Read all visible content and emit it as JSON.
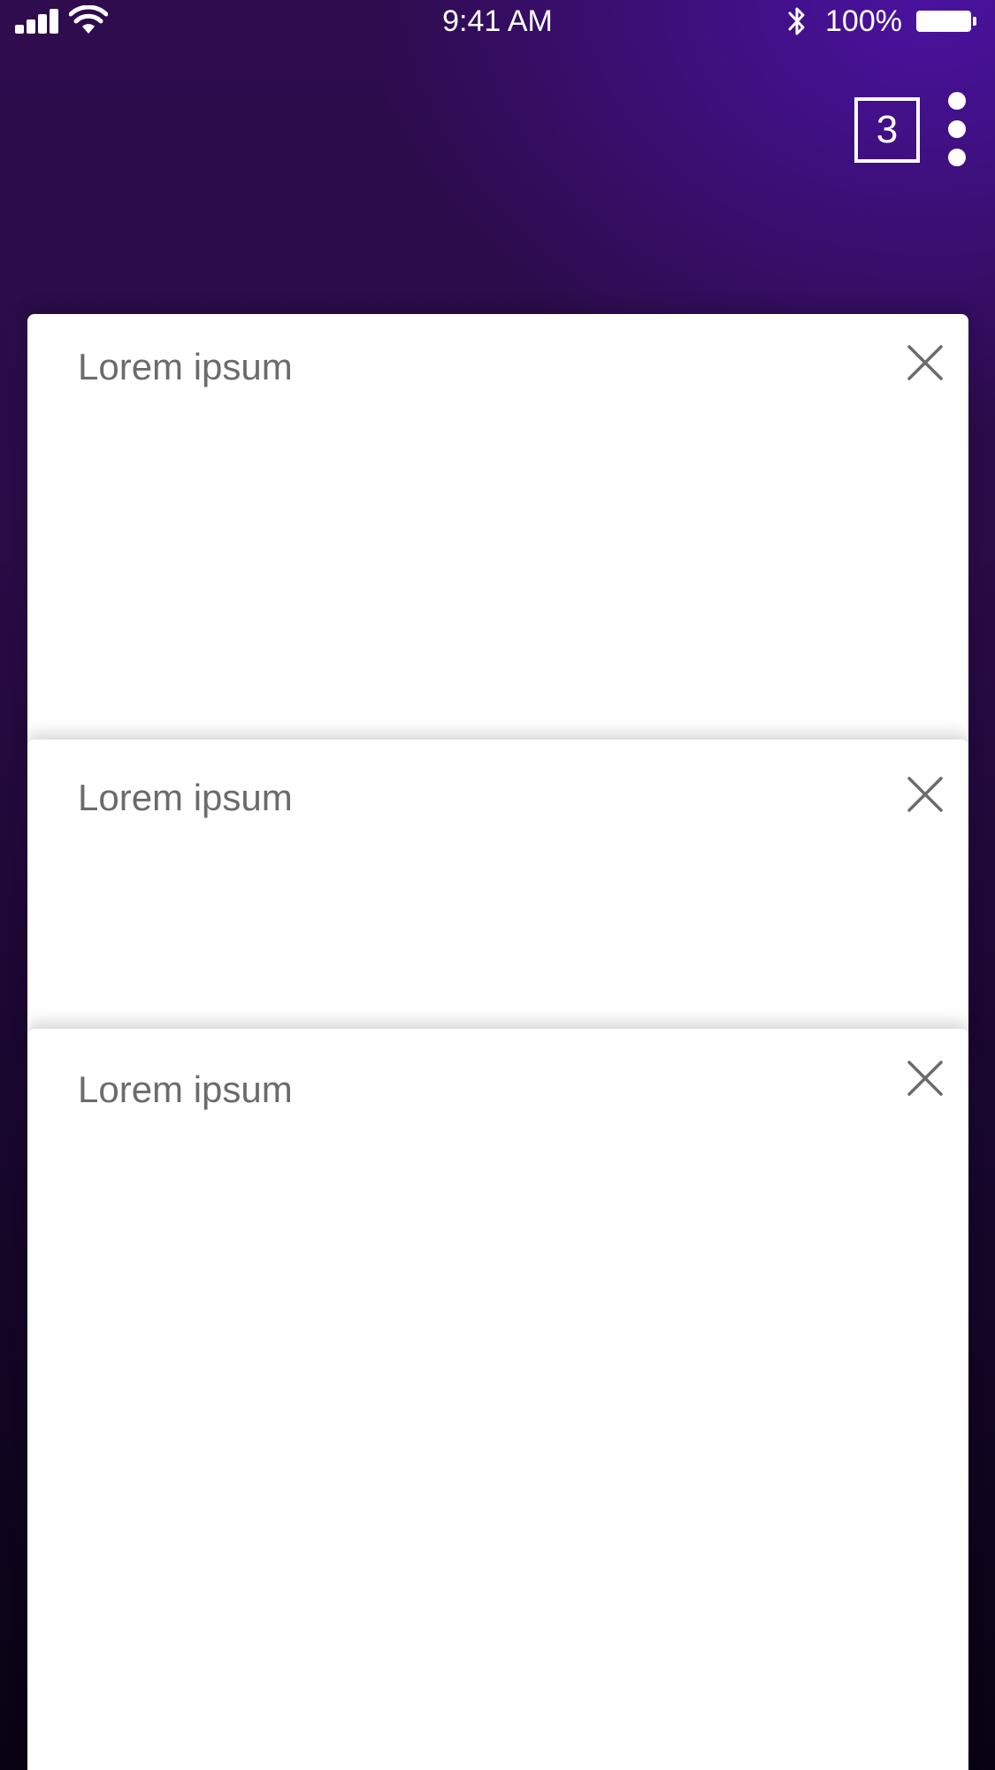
{
  "status_bar": {
    "time": "9:41 AM",
    "battery_percent": "100%",
    "signal_icon": "cellular-signal-icon",
    "wifi_icon": "wifi-icon",
    "bluetooth_icon": "bluetooth-icon",
    "battery_icon": "battery-icon",
    "battery_level": 1.0
  },
  "toolbar": {
    "tab_count": "3",
    "menu_icon": "more-vertical-icon"
  },
  "tabs": [
    {
      "title": "Lorem ipsum",
      "close_icon": "close-icon"
    },
    {
      "title": "Lorem ipsum",
      "close_icon": "close-icon"
    },
    {
      "title": "Lorem ipsum",
      "close_icon": "close-icon"
    }
  ],
  "colors": {
    "background_top": "#4a12a0",
    "background_bottom": "#080312",
    "card": "#ffffff",
    "card_text": "#6b6b6b"
  }
}
